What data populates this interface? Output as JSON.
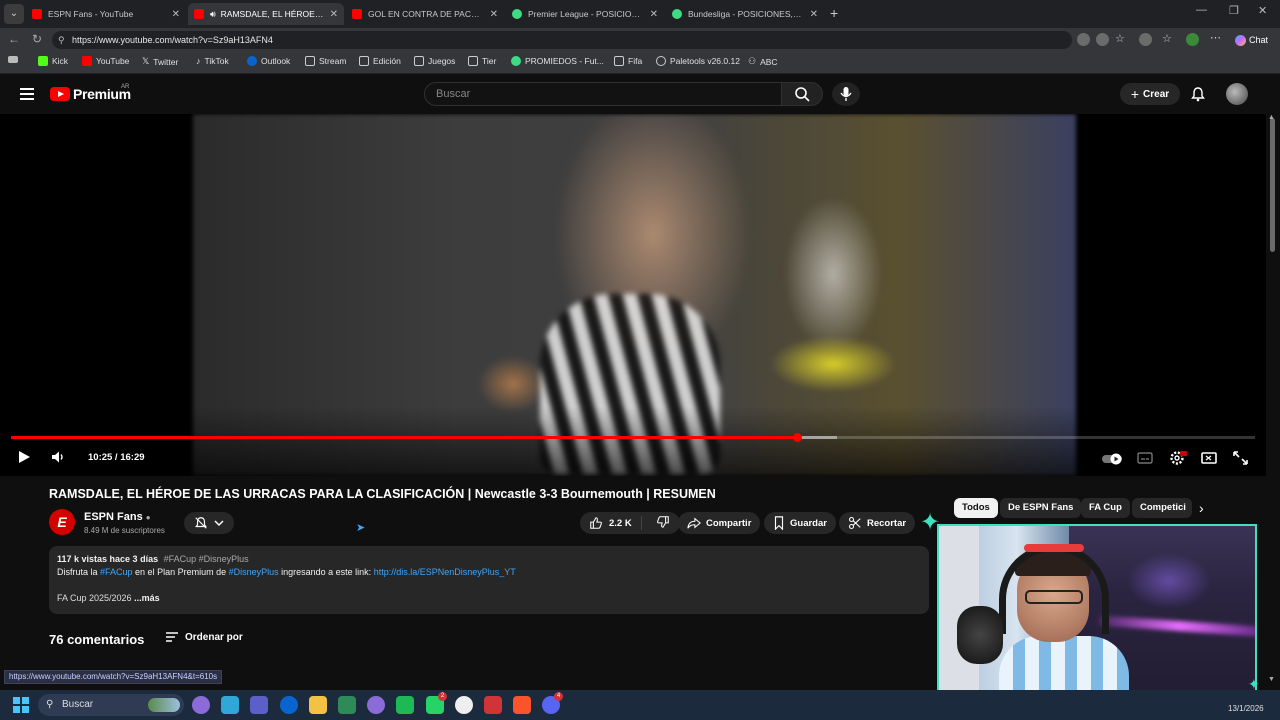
{
  "browser": {
    "tabs": [
      {
        "title": "ESPN Fans - YouTube",
        "favicon_color": "#ff0000",
        "active": false
      },
      {
        "title": "RAMSDALE, EL HÉROE DE LAS",
        "favicon_color": "#ff0000",
        "active": true
      },
      {
        "title": "GOL EN CONTRA DE PACHO PERÚ",
        "favicon_color": "#ff0000",
        "active": false
      },
      {
        "title": "Premier League - POSICIONES, RE",
        "favicon_color": "#3ddc84",
        "active": false
      },
      {
        "title": "Bundesliga - POSICIONES, RESULT",
        "favicon_color": "#3ddc84",
        "active": false
      }
    ],
    "url": "https://www.youtube.com/watch?v=Sz9aH13AFN4",
    "chat_label": "Chat",
    "bookmarks": [
      {
        "label": "Kick",
        "color": "#53fc18"
      },
      {
        "label": "YouTube",
        "color": "#ff0000"
      },
      {
        "label": "Twitter",
        "color": "#e8e8e8"
      },
      {
        "label": "TikTok",
        "color": "#e8e8e8"
      },
      {
        "label": "Outlook",
        "color": "#0a64d0"
      },
      {
        "label": "Stream",
        "color": "#c9c9c9"
      },
      {
        "label": "Edición",
        "color": "#c9c9c9"
      },
      {
        "label": "Juegos",
        "color": "#c9c9c9"
      },
      {
        "label": "Tier",
        "color": "#c9c9c9"
      },
      {
        "label": "PROMIEDOS - Fut...",
        "color": "#3ddc84"
      },
      {
        "label": "Fifa",
        "color": "#c9c9c9"
      },
      {
        "label": "Paletools v26.0.12",
        "color": "#c9c9c9"
      },
      {
        "label": "ABC",
        "color": "#c9c9c9"
      }
    ]
  },
  "youtube": {
    "logo_text": "Premium",
    "country_code": "AR",
    "search_placeholder": "Buscar",
    "create_label": "Crear"
  },
  "player": {
    "time_display": "10:25 / 16:29",
    "progress_fraction": 0.632,
    "buffered_fraction": 0.664
  },
  "video": {
    "title": "RAMSDALE, EL HÉROE DE LAS URRACAS PARA LA CLASIFICACIÓN | Newcastle 3-3 Bournemouth | RESUMEN",
    "channel_name": "ESPN Fans",
    "channel_logo_letter": "E",
    "subscribers": "8.49 M de suscriptores",
    "likes": "2.2 K",
    "share_label": "Compartir",
    "save_label": "Guardar",
    "clip_label": "Recortar",
    "chips": [
      "Todos",
      "De ESPN Fans",
      "FA Cup",
      "Competici"
    ],
    "description": {
      "stats": "117 k vistas  hace 3 días",
      "hashtags": "#FACup #DisneyPlus",
      "line2_a": "Disfruta la ",
      "line2_tag1": "#FACup",
      "line2_b": " en el Plan Premium de ",
      "line2_tag2": "#DisneyPlus",
      "line2_c": " ingresando a este link: ",
      "line2_link": "http://dis.la/ESPNenDisneyPlus_YT",
      "line3": "FA Cup 2025/2026",
      "more": "...más"
    },
    "comments_count": "76 comentarios",
    "sort_label": "Ordenar por"
  },
  "status_bar_url": "https://www.youtube.com/watch?v=Sz9aH13AFN4&t=610s",
  "taskbar": {
    "search_label": "Buscar",
    "date": "13/1/2026",
    "apps": [
      {
        "name": "copilot",
        "color": "#8a6bd8"
      },
      {
        "name": "edge",
        "color": "#2fa8d8"
      },
      {
        "name": "teams",
        "color": "#5b5fc7"
      },
      {
        "name": "outlook",
        "color": "#0a64d0"
      },
      {
        "name": "explorer",
        "color": "#f3c244"
      },
      {
        "name": "chrome",
        "color": "#2e8b57"
      },
      {
        "name": "discord-alt",
        "color": "#8a6bd8"
      },
      {
        "name": "spotify",
        "color": "#1db954"
      },
      {
        "name": "whatsapp",
        "color": "#25d366"
      },
      {
        "name": "capcut",
        "color": "#eeeeee"
      },
      {
        "name": "app-red",
        "color": "#d13438"
      },
      {
        "name": "brave",
        "color": "#fb542b"
      },
      {
        "name": "discord",
        "color": "#5865f2"
      }
    ],
    "badges": [
      "2",
      "4"
    ]
  }
}
